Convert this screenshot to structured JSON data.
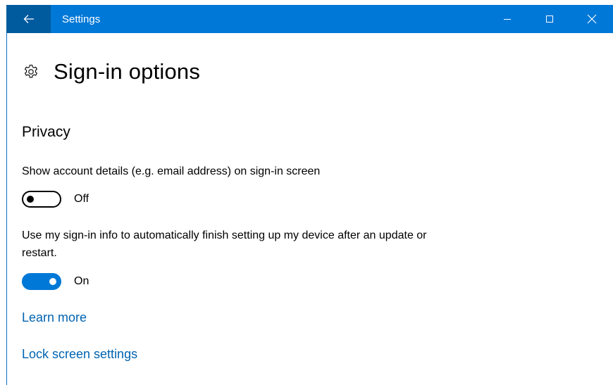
{
  "window": {
    "title": "Settings",
    "accent_color": "#0078d7",
    "back_button_color": "#005a9e",
    "icons": {
      "back": "arrow-left-icon",
      "minimize": "minimize-icon",
      "maximize": "maximize-icon",
      "close": "close-icon"
    }
  },
  "page": {
    "icon": "gear-icon",
    "title": "Sign-in options"
  },
  "privacy": {
    "section_title": "Privacy",
    "settings": [
      {
        "label": "Show account details (e.g. email address) on sign-in screen",
        "state": "off",
        "state_label": "Off"
      },
      {
        "label": "Use my sign-in info to automatically finish setting up my device after an update or restart.",
        "state": "on",
        "state_label": "On"
      }
    ]
  },
  "links": {
    "learn_more": "Learn more",
    "lock_screen_settings": "Lock screen settings",
    "link_color": "#0063b1"
  }
}
